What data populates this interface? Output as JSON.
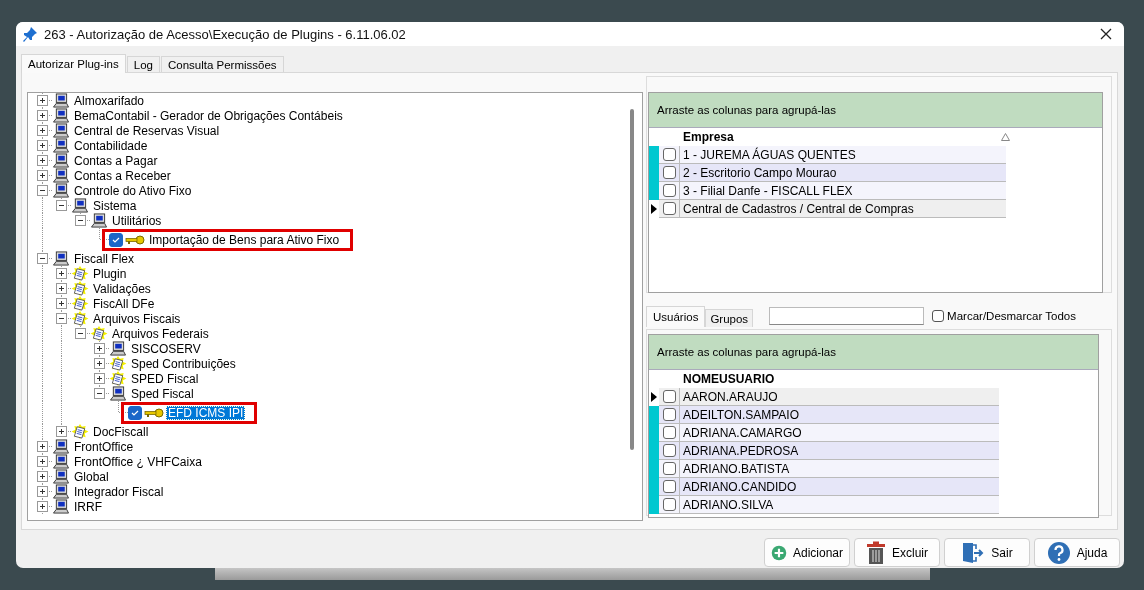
{
  "window": {
    "title": "263 - Autorização de Acesso\\Execução de Plugins - 6.11.06.02"
  },
  "tabs": [
    {
      "label": "Autorizar Plug-ins",
      "selected": true
    },
    {
      "label": "Log",
      "selected": false
    },
    {
      "label": "Consulta Permissões",
      "selected": false
    }
  ],
  "tree": {
    "items": [
      {
        "label": "Almoxarifado",
        "kind": "computer",
        "expanded": false
      },
      {
        "label": "BemaContabil - Gerador de Obrigações Contábeis",
        "kind": "computer",
        "expanded": false
      },
      {
        "label": "Central de Reservas Visual",
        "kind": "computer",
        "expanded": false
      },
      {
        "label": "Contabilidade",
        "kind": "computer",
        "expanded": false
      },
      {
        "label": "Contas a Pagar",
        "kind": "computer",
        "expanded": false
      },
      {
        "label": "Contas a Receber",
        "kind": "computer",
        "expanded": false
      },
      {
        "label": "Controle do Ativo Fixo",
        "kind": "computer",
        "expanded": true,
        "children": [
          {
            "label": "Sistema",
            "kind": "computer",
            "expanded": true,
            "children": [
              {
                "label": "Utilitários",
                "kind": "computer",
                "expanded": true,
                "children": [
                  {
                    "label": "Importação de Bens para Ativo Fixo",
                    "kind": "plugin",
                    "checked": true,
                    "selected": false,
                    "marked": true
                  }
                ]
              }
            ]
          }
        ]
      },
      {
        "label": "Fiscall Flex",
        "kind": "computer",
        "expanded": true,
        "children": [
          {
            "label": "Plugin",
            "kind": "document",
            "expanded": false
          },
          {
            "label": "Validações",
            "kind": "document",
            "expanded": false
          },
          {
            "label": "FiscAll DFe",
            "kind": "document",
            "expanded": false
          },
          {
            "label": "Arquivos Fiscais",
            "kind": "document",
            "expanded": true,
            "children": [
              {
                "label": "Arquivos Federais",
                "kind": "document",
                "expanded": true,
                "children": [
                  {
                    "label": "SISCOSERV",
                    "kind": "computer",
                    "expanded": false
                  },
                  {
                    "label": "Sped Contribuições",
                    "kind": "document",
                    "expanded": false
                  },
                  {
                    "label": "SPED Fiscal",
                    "kind": "document",
                    "expanded": false
                  },
                  {
                    "label": "Sped Fiscal",
                    "kind": "computer",
                    "expanded": true,
                    "children": [
                      {
                        "label": "EFD ICMS IPI",
                        "kind": "plugin",
                        "checked": true,
                        "selected": true,
                        "marked": true
                      }
                    ]
                  }
                ]
              }
            ]
          },
          {
            "label": "DocFiscall",
            "kind": "document",
            "expanded": false
          }
        ]
      },
      {
        "label": "FrontOffice",
        "kind": "computer",
        "expanded": false
      },
      {
        "label": "FrontOffice ¿ VHFCaixa",
        "kind": "computer",
        "expanded": false
      },
      {
        "label": "Global",
        "kind": "computer",
        "expanded": false
      },
      {
        "label": "Integrador Fiscal",
        "kind": "computer",
        "expanded": false
      },
      {
        "label": "IRRF",
        "kind": "computer",
        "expanded": false
      }
    ]
  },
  "companies": {
    "group_hint": "Arraste as colunas para agrupá-las",
    "column": "Empresa",
    "rows": [
      {
        "name": "1 - JUREMA ÁGUAS QUENTES",
        "checked": false,
        "current": false
      },
      {
        "name": "2 - Escritorio Campo Mourao",
        "checked": false,
        "current": false
      },
      {
        "name": "3 - Filial Danfe - FISCALL FLEX",
        "checked": false,
        "current": false
      },
      {
        "name": "Central de Cadastros / Central de Compras",
        "checked": false,
        "current": true
      }
    ]
  },
  "users": {
    "tabs": [
      {
        "label": "Usuários",
        "selected": true
      },
      {
        "label": "Grupos",
        "selected": false
      }
    ],
    "select_all": {
      "label": "Marcar/Desmarcar Todos",
      "checked": false
    },
    "group_hint": "Arraste as colunas para agrupá-las",
    "column": "NOMEUSUARIO",
    "rows": [
      {
        "name": "AARON.ARAUJO",
        "checked": false,
        "current": true
      },
      {
        "name": "ADEILTON.SAMPAIO",
        "checked": false,
        "current": false
      },
      {
        "name": "ADRIANA.CAMARGO",
        "checked": false,
        "current": false
      },
      {
        "name": "ADRIANA.PEDROSA",
        "checked": false,
        "current": false
      },
      {
        "name": "ADRIANO.BATISTA",
        "checked": false,
        "current": false
      },
      {
        "name": "ADRIANO.CANDIDO",
        "checked": false,
        "current": false
      },
      {
        "name": "ADRIANO.SILVA",
        "checked": false,
        "current": false
      }
    ]
  },
  "buttons": [
    {
      "label": "Adicionar",
      "kind": "add"
    },
    {
      "label": "Excluir",
      "kind": "delete"
    },
    {
      "label": "Sair",
      "kind": "exit"
    },
    {
      "label": "Ajuda",
      "kind": "help"
    }
  ]
}
